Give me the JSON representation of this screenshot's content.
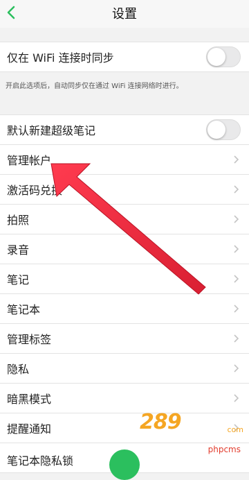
{
  "header": {
    "title": "设置"
  },
  "settings": {
    "wifi_sync": {
      "label": "仅在 WiFi 连接时同步",
      "hint": "开启此选项后，自动同步仅在通过 WiFi 连接网络时进行。"
    },
    "default_super_note": {
      "label": "默认新建超级笔记"
    },
    "items": [
      {
        "label": "管理帐户"
      },
      {
        "label": "激活码兑换"
      },
      {
        "label": "拍照"
      },
      {
        "label": "录音"
      },
      {
        "label": "笔记"
      },
      {
        "label": "笔记本"
      },
      {
        "label": "管理标签"
      },
      {
        "label": "隐私"
      },
      {
        "label": "暗黑模式"
      },
      {
        "label": "提醒通知"
      },
      {
        "label": "笔记本隐私锁"
      }
    ]
  },
  "watermark": {
    "logo": "289",
    "site": "com",
    "tag": "phpcms"
  },
  "colors": {
    "accent_green": "#2bbf5e",
    "arrow_red": "#e8283c"
  }
}
